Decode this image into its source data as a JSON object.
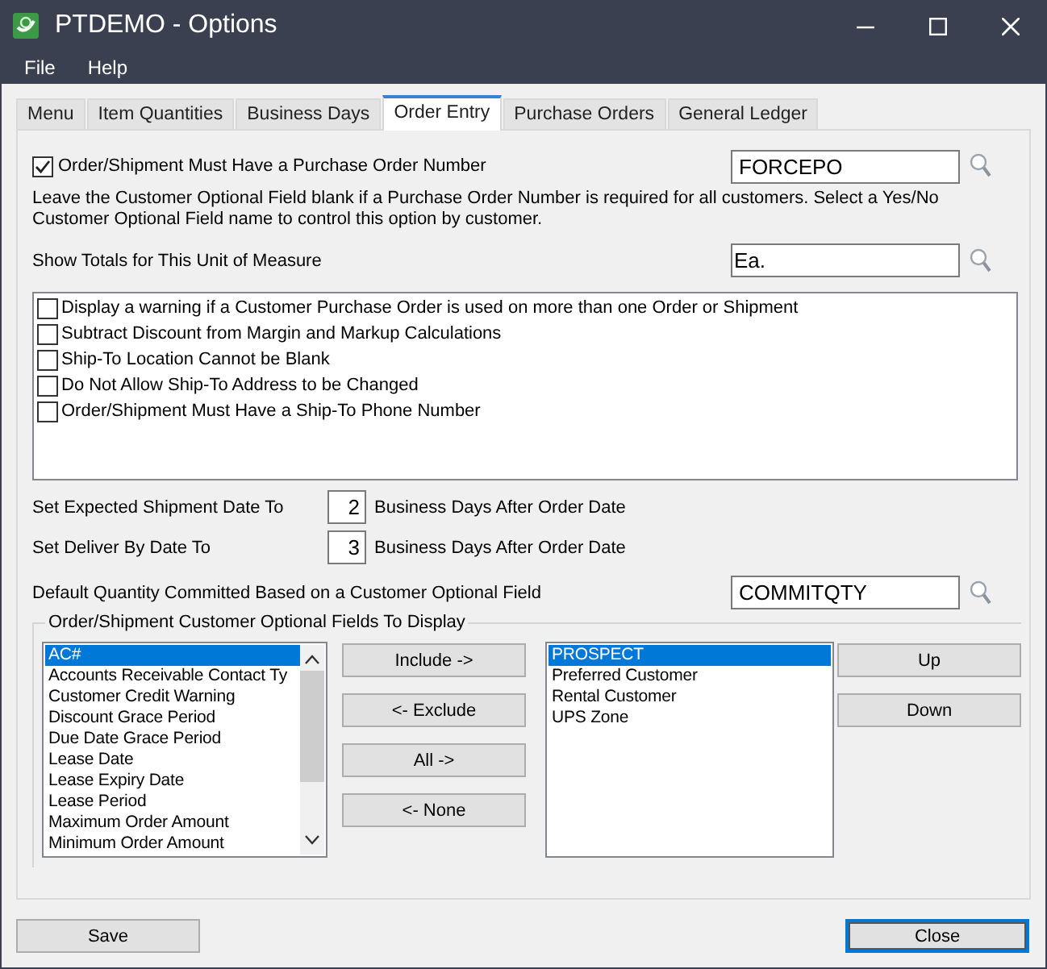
{
  "window": {
    "title": "PTDEMO - Options"
  },
  "menu": [
    "File",
    "Help"
  ],
  "tabs": [
    {
      "label": "Menu",
      "selected": false
    },
    {
      "label": "Item Quantities",
      "selected": false
    },
    {
      "label": "Business Days",
      "selected": false
    },
    {
      "label": "Order Entry",
      "selected": true
    },
    {
      "label": "Purchase Orders",
      "selected": false
    },
    {
      "label": "General Ledger",
      "selected": false
    }
  ],
  "po_required": {
    "label": "Order/Shipment Must Have a Purchase Order Number",
    "checked": true,
    "field_value": "FORCEPO"
  },
  "note": "Leave the Customer Optional Field blank if a Purchase Order Number is required for all customers. Select a Yes/No Customer Optional Field name to control this option by customer.",
  "unit_of_measure": {
    "label": "Show Totals for This Unit of Measure",
    "value": "Ea."
  },
  "options": [
    {
      "label": "Display a warning if a Customer Purchase Order is used on more than one Order or Shipment",
      "checked": false
    },
    {
      "label": "Subtract Discount from Margin and Markup Calculations",
      "checked": false
    },
    {
      "label": "Ship-To Location Cannot be Blank",
      "checked": false
    },
    {
      "label": "Do Not Allow Ship-To Address to be Changed",
      "checked": false
    },
    {
      "label": "Order/Shipment Must Have a Ship-To Phone Number",
      "checked": false
    }
  ],
  "day_settings": [
    {
      "label": "Set Expected Shipment Date To",
      "value": "2",
      "suffix": "Business Days After Order Date"
    },
    {
      "label": "Set Deliver By Date To",
      "value": "3",
      "suffix": "Business Days After Order Date"
    }
  ],
  "default_quantity": {
    "label": "Default Quantity Committed Based on a Customer Optional Field",
    "value": "COMMITQTY"
  },
  "optional_fields": {
    "title": "Order/Shipment Customer Optional Fields To Display",
    "available": [
      {
        "label": "AC#",
        "selected": true
      },
      {
        "label": "Accounts Receivable Contact Ty",
        "selected": false
      },
      {
        "label": "Customer Credit Warning",
        "selected": false
      },
      {
        "label": "Discount Grace Period",
        "selected": false
      },
      {
        "label": "Due Date Grace Period",
        "selected": false
      },
      {
        "label": "Lease Date",
        "selected": false
      },
      {
        "label": "Lease Expiry Date",
        "selected": false
      },
      {
        "label": "Lease Period",
        "selected": false
      },
      {
        "label": "Maximum Order Amount",
        "selected": false
      },
      {
        "label": "Minimum Order Amount",
        "selected": false
      }
    ],
    "move_buttons": [
      "Include ->",
      "<- Exclude",
      "All ->",
      "<- None"
    ],
    "displayed": [
      {
        "label": "PROSPECT",
        "selected": true
      },
      {
        "label": "Preferred Customer",
        "selected": false
      },
      {
        "label": "Rental Customer",
        "selected": false
      },
      {
        "label": "UPS Zone",
        "selected": false
      }
    ],
    "order_buttons": [
      "Up",
      "Down"
    ]
  },
  "footer_buttons": [
    {
      "label": "Save",
      "default": false
    },
    {
      "label": "Close",
      "default": true
    }
  ]
}
